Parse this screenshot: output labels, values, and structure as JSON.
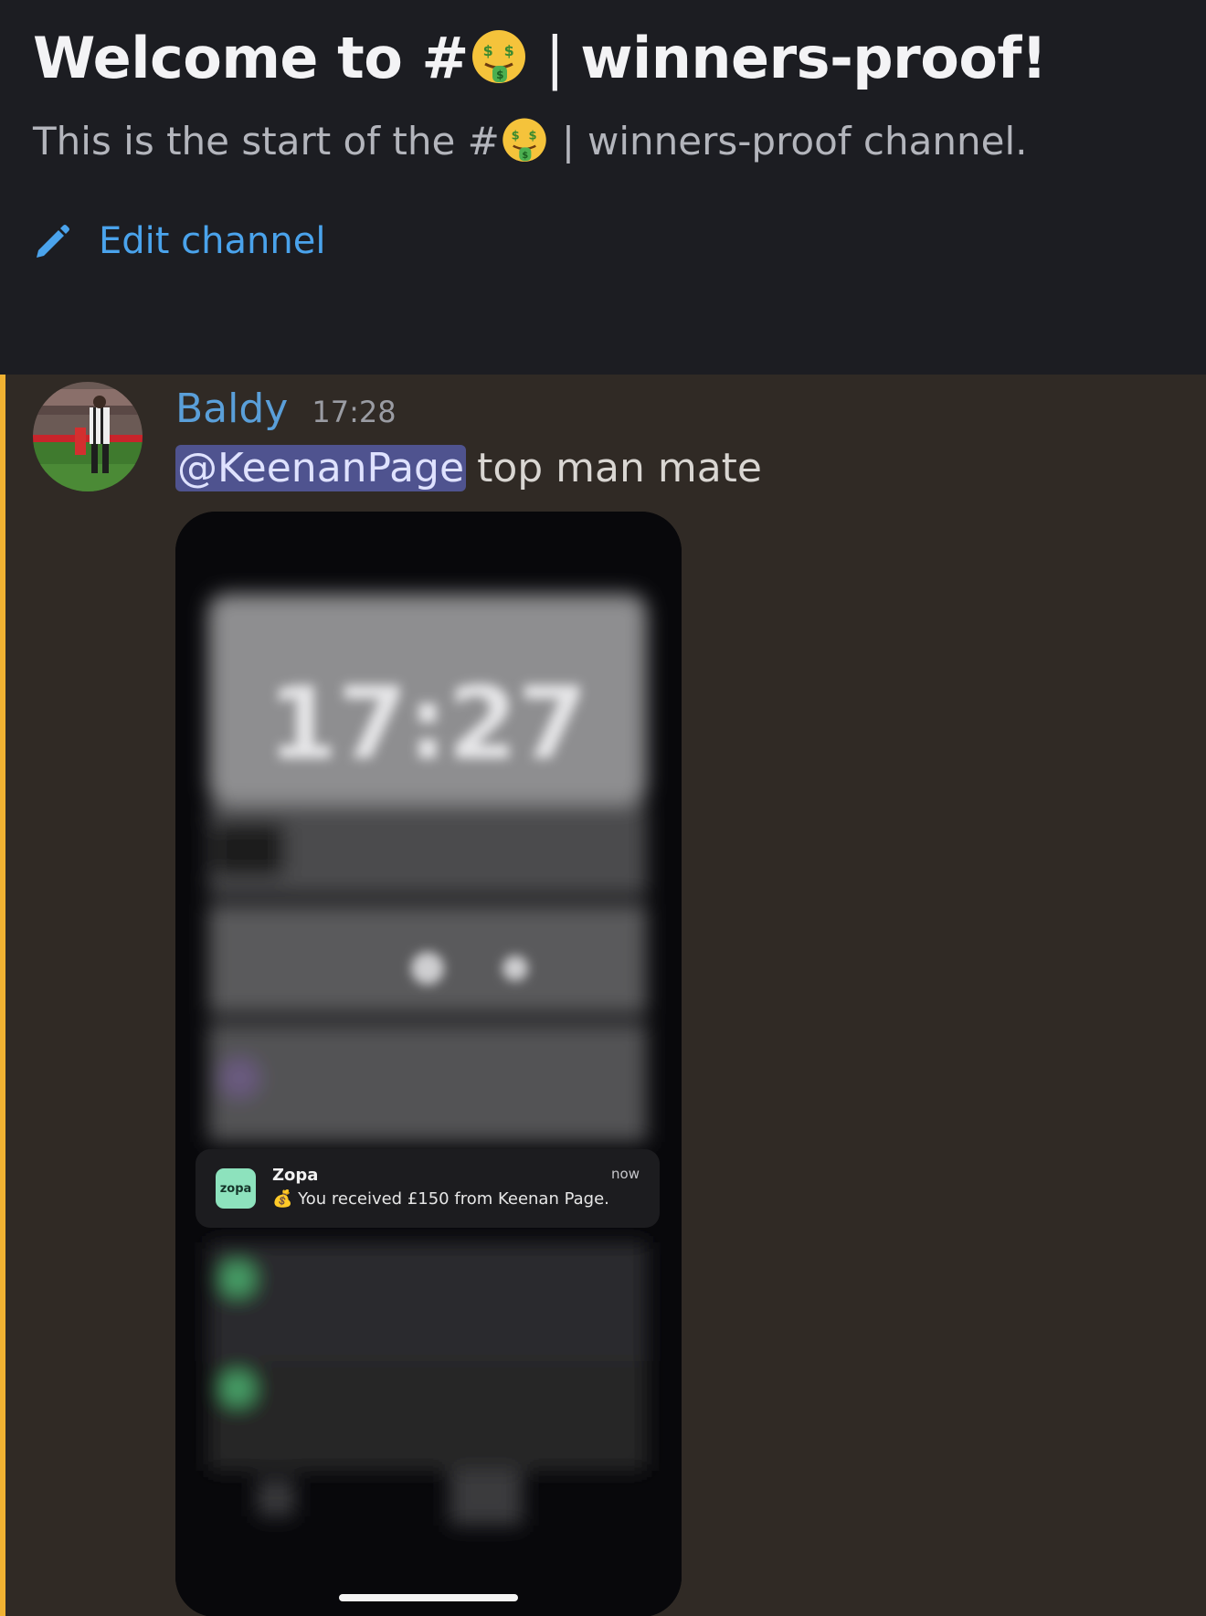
{
  "header": {
    "welcome_prefix": "Welcome to #",
    "welcome_channel_name": "winners-proof!",
    "subtitle_prefix": "This is the start of the #",
    "subtitle_suffix": "winners-proof channel.",
    "separator": "|",
    "edit_channel_label": "Edit channel",
    "emoji": "money-mouth-face",
    "accent_color": "#4aa3ec"
  },
  "message": {
    "author": "Baldy",
    "timestamp": "17:28",
    "mention": "@KeenanPage",
    "text": "top man mate",
    "author_color": "#5a9fd9",
    "mention_highlight": "#f0b232"
  },
  "attachment": {
    "blurred_clock": "17:27",
    "notification": {
      "icon_text": "zopa",
      "app": "Zopa",
      "time": "now",
      "emoji": "💰",
      "message": "You received £150 from Keenan Page."
    }
  }
}
